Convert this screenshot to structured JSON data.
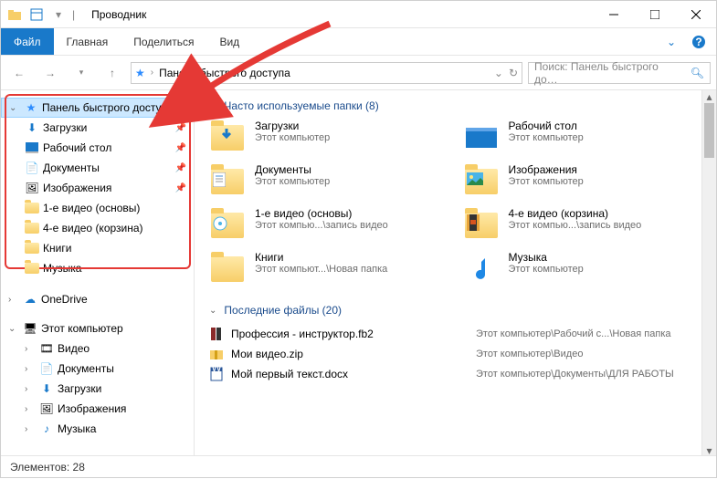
{
  "window": {
    "title": "Проводник"
  },
  "ribbon": {
    "file": "Файл",
    "home": "Главная",
    "share": "Поделиться",
    "view": "Вид"
  },
  "address": {
    "crumb": "Панель быстрого доступа"
  },
  "search": {
    "placeholder": "Поиск: Панель быстрого до…"
  },
  "nav": {
    "quick_access": "Панель быстрого доступа",
    "items": [
      {
        "label": "Загрузки",
        "pinned": true,
        "icon": "download"
      },
      {
        "label": "Рабочий стол",
        "pinned": true,
        "icon": "desktop"
      },
      {
        "label": "Документы",
        "pinned": true,
        "icon": "document"
      },
      {
        "label": "Изображения",
        "pinned": true,
        "icon": "picture"
      },
      {
        "label": "1-е видео (основы)",
        "pinned": false,
        "icon": "folder"
      },
      {
        "label": "4-е видео (корзина)",
        "pinned": false,
        "icon": "folder"
      },
      {
        "label": "Книги",
        "pinned": false,
        "icon": "folder"
      },
      {
        "label": "Музыка",
        "pinned": false,
        "icon": "folder"
      }
    ],
    "onedrive": "OneDrive",
    "this_pc": "Этот компьютер",
    "pc_items": [
      {
        "label": "Видео",
        "icon": "video"
      },
      {
        "label": "Документы",
        "icon": "document"
      },
      {
        "label": "Загрузки",
        "icon": "download"
      },
      {
        "label": "Изображения",
        "icon": "picture"
      },
      {
        "label": "Музыка",
        "icon": "music"
      }
    ]
  },
  "main": {
    "freq_header": "Часто используемые папки (8)",
    "folders": [
      {
        "name": "Загрузки",
        "sub": "Этот компьютер",
        "icon": "download"
      },
      {
        "name": "Рабочий стол",
        "sub": "Этот компьютер",
        "icon": "desktop"
      },
      {
        "name": "Документы",
        "sub": "Этот компьютер",
        "icon": "document"
      },
      {
        "name": "Изображения",
        "sub": "Этот компьютер",
        "icon": "picture"
      },
      {
        "name": "1-е видео (основы)",
        "sub": "Этот компью...\\запись видео",
        "icon": "folder-cd"
      },
      {
        "name": "4-е видео (корзина)",
        "sub": "Этот компью...\\запись видео",
        "icon": "folder-vid"
      },
      {
        "name": "Книги",
        "sub": "Этот компьют...\\Новая папка",
        "icon": "folder"
      },
      {
        "name": "Музыка",
        "sub": "Этот компьютер",
        "icon": "music"
      }
    ],
    "recent_header": "Последние файлы (20)",
    "files": [
      {
        "name": "Профессия - инструктор.fb2",
        "loc": "Этот компьютер\\Рабочий с...\\Новая папка",
        "icon": "book"
      },
      {
        "name": "Мои видео.zip",
        "loc": "Этот компьютер\\Видео",
        "icon": "zip"
      },
      {
        "name": "Мой первый текст.docx",
        "loc": "Этот компьютер\\Документы\\ДЛЯ РАБОТЫ",
        "icon": "docx"
      }
    ]
  },
  "status": {
    "count": "Элементов: 28"
  }
}
